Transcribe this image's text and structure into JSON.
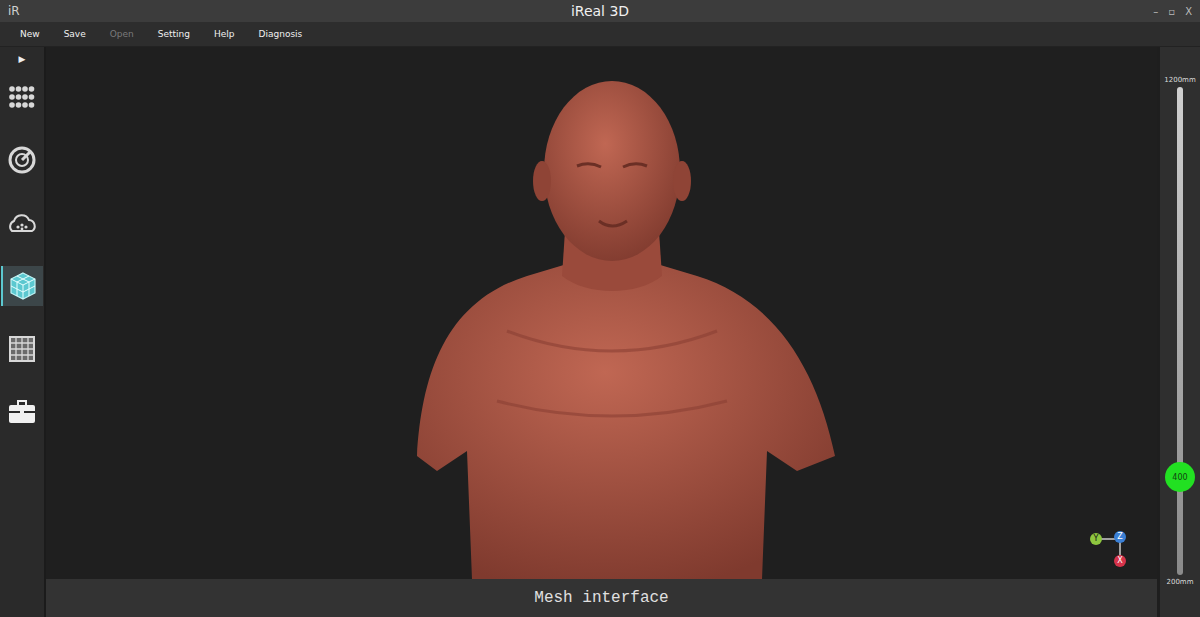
{
  "window": {
    "logo": "iR",
    "title": "iReal 3D",
    "controls": [
      "–",
      "▫",
      "X"
    ]
  },
  "menu": [
    {
      "label": "New",
      "disabled": false
    },
    {
      "label": "Save",
      "disabled": false
    },
    {
      "label": "Open",
      "disabled": true
    },
    {
      "label": "Setting",
      "disabled": false
    },
    {
      "label": "Help",
      "disabled": false
    },
    {
      "label": "Diagnosis",
      "disabled": false
    }
  ],
  "sidebar": {
    "toggle": "▶",
    "items": [
      {
        "selected": false
      },
      {
        "selected": false
      },
      {
        "selected": false
      },
      {
        "selected": true
      },
      {
        "selected": false
      },
      {
        "selected": false
      }
    ]
  },
  "axes": [
    {
      "label": "Y",
      "color": "#8ec63f"
    },
    {
      "label": "Z",
      "color": "#3a7fd5"
    },
    {
      "label": "X",
      "color": "#d6334a"
    }
  ],
  "distance_slider": {
    "max_label": "1200mm",
    "min_label": "200mm",
    "reading": "400",
    "level": 0.2
  },
  "status_bar": "Mesh interface"
}
